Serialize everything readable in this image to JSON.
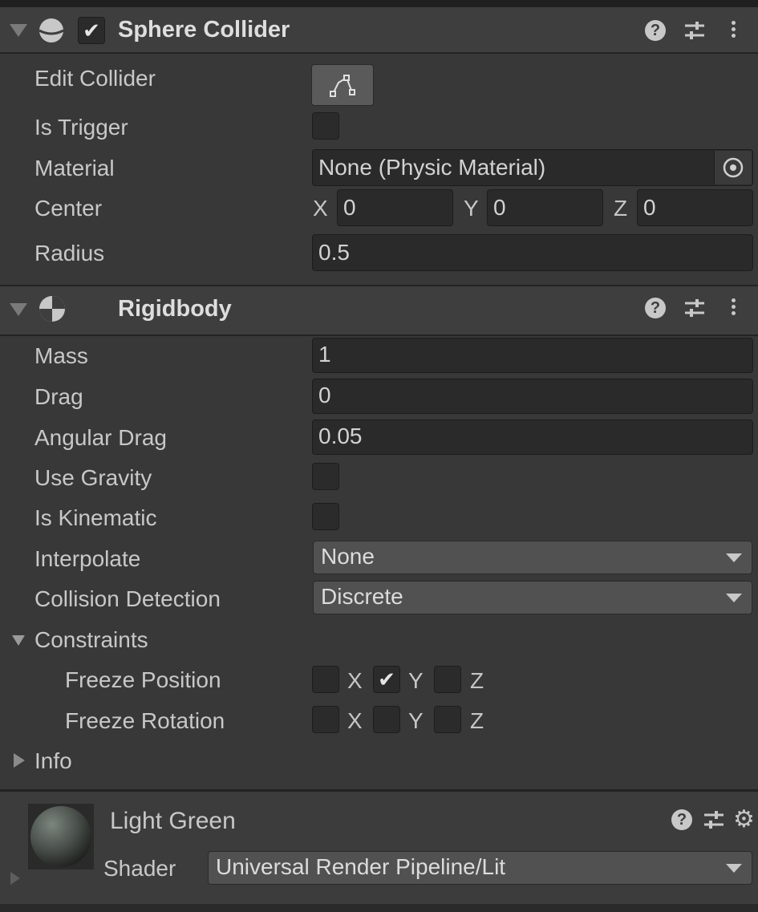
{
  "sphere_collider": {
    "title": "Sphere Collider",
    "enabled": true,
    "rows": {
      "edit_collider": "Edit Collider",
      "is_trigger": "Is Trigger",
      "material": "Material",
      "center": "Center",
      "radius": "Radius"
    },
    "material_value": "None (Physic Material)",
    "center": {
      "x_label": "X",
      "x": "0",
      "y_label": "Y",
      "y": "0",
      "z_label": "Z",
      "z": "0"
    },
    "radius_value": "0.5",
    "is_trigger_checked": false
  },
  "rigidbody": {
    "title": "Rigidbody",
    "rows": {
      "mass": "Mass",
      "drag": "Drag",
      "angular_drag": "Angular Drag",
      "use_gravity": "Use Gravity",
      "is_kinematic": "Is Kinematic",
      "interpolate": "Interpolate",
      "collision_detection": "Collision Detection",
      "constraints": "Constraints",
      "freeze_position": "Freeze Position",
      "freeze_rotation": "Freeze Rotation",
      "info": "Info"
    },
    "mass_value": "1",
    "drag_value": "0",
    "angular_drag_value": "0.05",
    "interpolate_value": "None",
    "collision_detection_value": "Discrete",
    "freeze_position": {
      "x": false,
      "y": true,
      "z": false
    },
    "freeze_rotation": {
      "x": false,
      "y": false,
      "z": false
    },
    "axis": {
      "x": "X",
      "y": "Y",
      "z": "Z"
    }
  },
  "material_asset": {
    "name": "Light Green",
    "shader_label": "Shader",
    "shader_value": "Universal Render Pipeline/Lit"
  },
  "icons": {
    "help": "help-icon",
    "presets": "presets-icon",
    "menu": "kebab-menu-icon",
    "settings": "gear-icon",
    "target": "object-picker-icon"
  },
  "colors": {
    "panel_bg": "#383838",
    "header_bg": "#3e3e3e",
    "field_bg": "#2a2a2a",
    "dropdown_bg": "#515151"
  }
}
